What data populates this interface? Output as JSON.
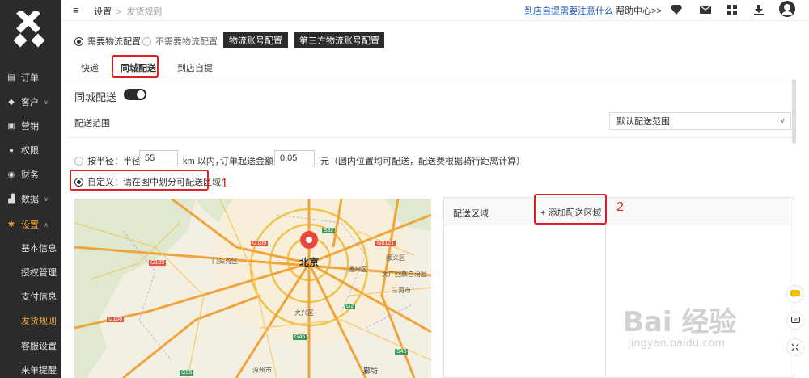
{
  "sidebar": {
    "items": [
      {
        "label": "订单",
        "icon": "clipboard-icon"
      },
      {
        "label": "客户",
        "icon": "diamond-icon"
      },
      {
        "label": "营销",
        "icon": "ticket-icon"
      },
      {
        "label": "权限",
        "icon": "user-icon"
      },
      {
        "label": "财务",
        "icon": "money-icon"
      },
      {
        "label": "数据",
        "icon": "chart-icon"
      },
      {
        "label": "设置",
        "icon": "gear-icon"
      }
    ],
    "sub_items": [
      "基本信息",
      "授权管理",
      "支付信息",
      "发货规则",
      "客服设置",
      "来单提醒"
    ],
    "active_sub": "发货规则"
  },
  "header": {
    "breadcrumb_root": "设置",
    "breadcrumb_sep": ">",
    "breadcrumb_current": "发货规则",
    "notice_link": "到店自提需要注意什么",
    "help": "帮助中心>>"
  },
  "main": {
    "logistics_options": [
      "需要物流配置",
      "不需要物流配置"
    ],
    "buttons": [
      "物流账号配置",
      "第三方物流账号配置"
    ],
    "tabs": [
      "快递",
      "同城配送",
      "到店自提"
    ],
    "delivery_label": "同城配送",
    "range_label": "配送范围",
    "range_select": "默认配送范围",
    "radius": {
      "prefix": "按半径：半径",
      "radius_value": "55",
      "unit": "km 以内，",
      "min_label": "订单起送金额",
      "min_value": "0.05",
      "suffix": "元（圆内位置均可配送，配送费根据骑行距离计算）"
    },
    "custom_label": "自定义：请在图中划分可配送区域",
    "annotation_1": "1",
    "annotation_2": "2",
    "zone_header": "配送区域",
    "add_zone": "+ 添加配送区域"
  },
  "map": {
    "city": "北京",
    "labels": [
      "G109",
      "G109",
      "门头沟区",
      "S32",
      "G0121",
      "顺义区",
      "通州区",
      "大厂回族自治县",
      "三河市",
      "大兴区",
      "G45",
      "S40",
      "G108",
      "G95",
      "廊坊",
      "涿州市",
      "G2"
    ]
  },
  "watermark": {
    "text": "Bai  经验",
    "url": "jingyan.baidu.com"
  },
  "colors": {
    "sidebar_bg": "#2b2b2b",
    "active": "#f0a43c",
    "highlight": "#e02020",
    "link": "#2a5db0"
  }
}
